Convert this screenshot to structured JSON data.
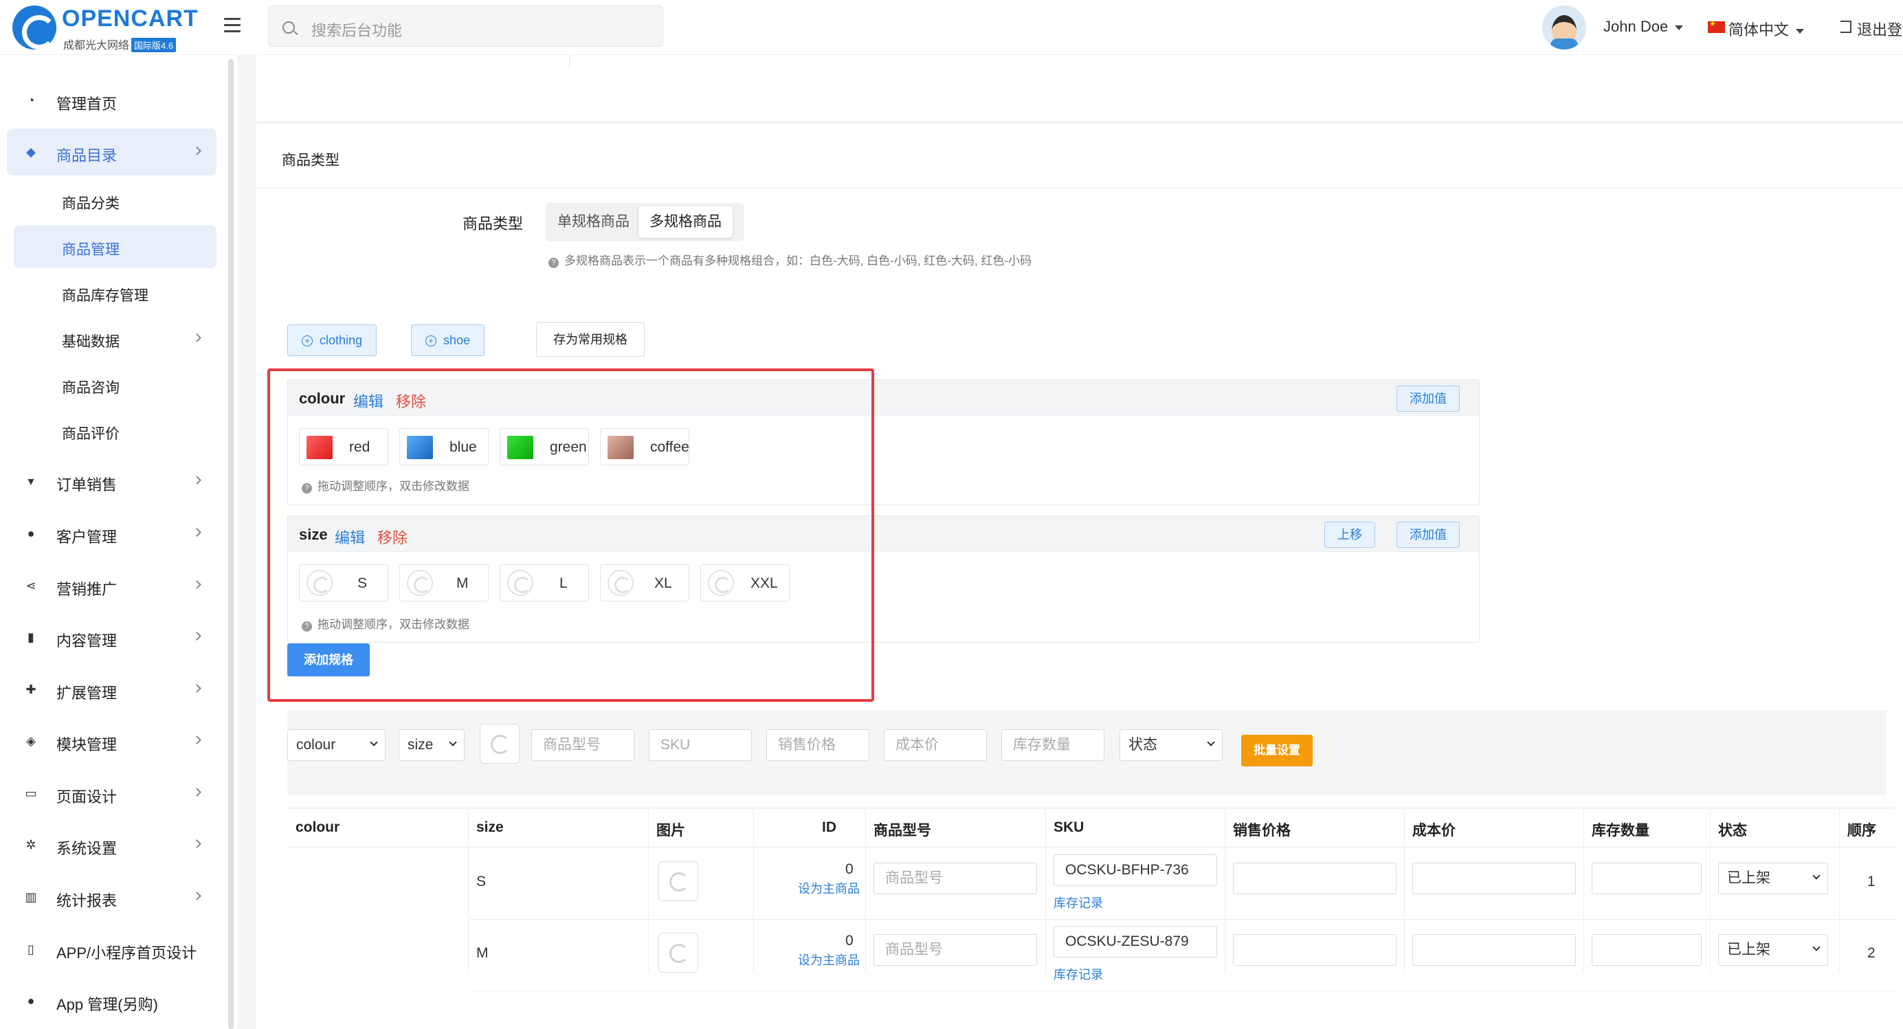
{
  "header": {
    "brand": "OPENCART",
    "brand_sub": "成都光大网络",
    "brand_badge": "国际版4.6",
    "search_placeholder": "搜索后台功能",
    "user_name": "John Doe",
    "language": "简体中文",
    "logout": "退出登"
  },
  "sidebar": {
    "items": [
      {
        "label": "管理首页",
        "icon": "dashboard-icon"
      },
      {
        "label": "商品目录",
        "icon": "tag-icon"
      },
      {
        "label": "订单销售",
        "icon": "cart-icon"
      },
      {
        "label": "客户管理",
        "icon": "user-icon"
      },
      {
        "label": "营销推广",
        "icon": "share-icon"
      },
      {
        "label": "内容管理",
        "icon": "book-icon"
      },
      {
        "label": "扩展管理",
        "icon": "puzzle-icon"
      },
      {
        "label": "模块管理",
        "icon": "cube-icon"
      },
      {
        "label": "页面设计",
        "icon": "desktop-icon"
      },
      {
        "label": "系统设置",
        "icon": "gear-icon"
      },
      {
        "label": "统计报表",
        "icon": "chart-icon"
      },
      {
        "label": "APP/小程序首页设计",
        "icon": "mobile-icon"
      },
      {
        "label": "App 管理(另购)",
        "icon": "apple-icon"
      }
    ],
    "sub_items": [
      {
        "label": "商品分类"
      },
      {
        "label": "商品管理"
      },
      {
        "label": "商品库存管理"
      },
      {
        "label": "基础数据"
      },
      {
        "label": "商品咨询"
      },
      {
        "label": "商品评价"
      }
    ]
  },
  "product_type": {
    "section_title": "商品类型",
    "field_label": "商品类型",
    "options": [
      "单规格商品",
      "多规格商品"
    ],
    "selected": "多规格商品",
    "hint": "多规格商品表示一个商品有多种规格组合，如：白色-大码, 白色-小码, 红色-大码, 红色-小码"
  },
  "spec_templates": {
    "tags": [
      "clothing",
      "shoe"
    ],
    "save_label": "存为常用规格"
  },
  "specs": [
    {
      "name": "colour",
      "edit": "编辑",
      "remove": "移除",
      "add_value": "添加值",
      "values": [
        {
          "label": "red",
          "color": "#f03b3b"
        },
        {
          "label": "blue",
          "color": "#2f8ae0"
        },
        {
          "label": "green",
          "color": "#1ecb1e"
        },
        {
          "label": "coffee",
          "color": "#c48f7e"
        }
      ],
      "hint": "拖动调整顺序，双击修改数据"
    },
    {
      "name": "size",
      "edit": "编辑",
      "remove": "移除",
      "move_up": "上移",
      "add_value": "添加值",
      "values": [
        {
          "label": "S"
        },
        {
          "label": "M"
        },
        {
          "label": "L"
        },
        {
          "label": "XL"
        },
        {
          "label": "XXL"
        }
      ],
      "hint": "拖动调整顺序，双击修改数据"
    }
  ],
  "add_spec_label": "添加规格",
  "batch": {
    "colour_select": "colour",
    "size_select": "size",
    "model_placeholder": "商品型号",
    "sku_placeholder": "SKU",
    "price_placeholder": "销售价格",
    "cost_placeholder": "成本价",
    "stock_placeholder": "库存数量",
    "status_select": "状态",
    "apply_label": "批量设置"
  },
  "variants_table": {
    "headers": [
      "colour",
      "size",
      "图片",
      "ID",
      "商品型号",
      "SKU",
      "销售价格",
      "成本价",
      "库存数量",
      "状态",
      "顺序"
    ],
    "rows": [
      {
        "size": "S",
        "id": "0",
        "set_master": "设为主商品",
        "model_placeholder": "商品型号",
        "sku": "OCSKU-BFHP-736",
        "stock_log": "库存记录",
        "status": "已上架",
        "order": "1"
      },
      {
        "size": "M",
        "id": "0",
        "set_master": "设为主商品",
        "model_placeholder": "商品型号",
        "sku": "OCSKU-ZESU-879",
        "stock_log": "库存记录",
        "status": "已上架",
        "order": "2"
      }
    ]
  }
}
